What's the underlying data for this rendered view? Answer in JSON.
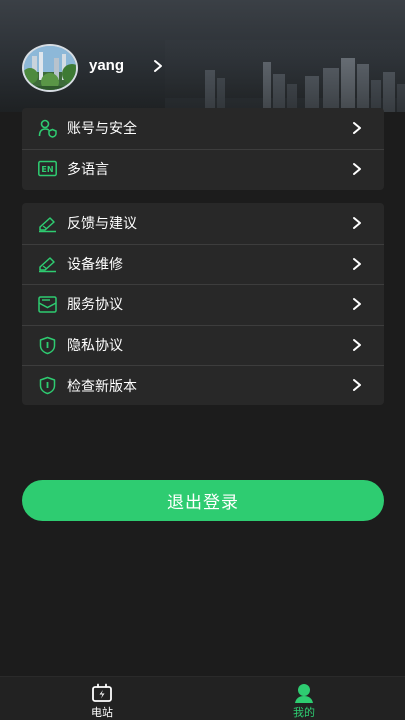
{
  "profile": {
    "username": "yang"
  },
  "account_group": [
    {
      "label": "账号与安全",
      "icon": "user-shield-icon"
    },
    {
      "label": "多语言",
      "icon": "language-en-icon"
    }
  ],
  "settings_group": [
    {
      "label": "反馈与建议",
      "icon": "feedback-icon"
    },
    {
      "label": "设备维修",
      "icon": "repair-icon"
    },
    {
      "label": "服务协议",
      "icon": "agreement-icon"
    },
    {
      "label": "隐私协议",
      "icon": "privacy-shield-icon"
    },
    {
      "label": "检查新版本",
      "icon": "version-shield-icon"
    }
  ],
  "logout_label": "退出登录",
  "tabbar": {
    "station_label": "电站",
    "mine_label": "我的"
  },
  "colors": {
    "accent": "#2ecc71",
    "background": "#1c1c1c",
    "card": "#282828"
  }
}
